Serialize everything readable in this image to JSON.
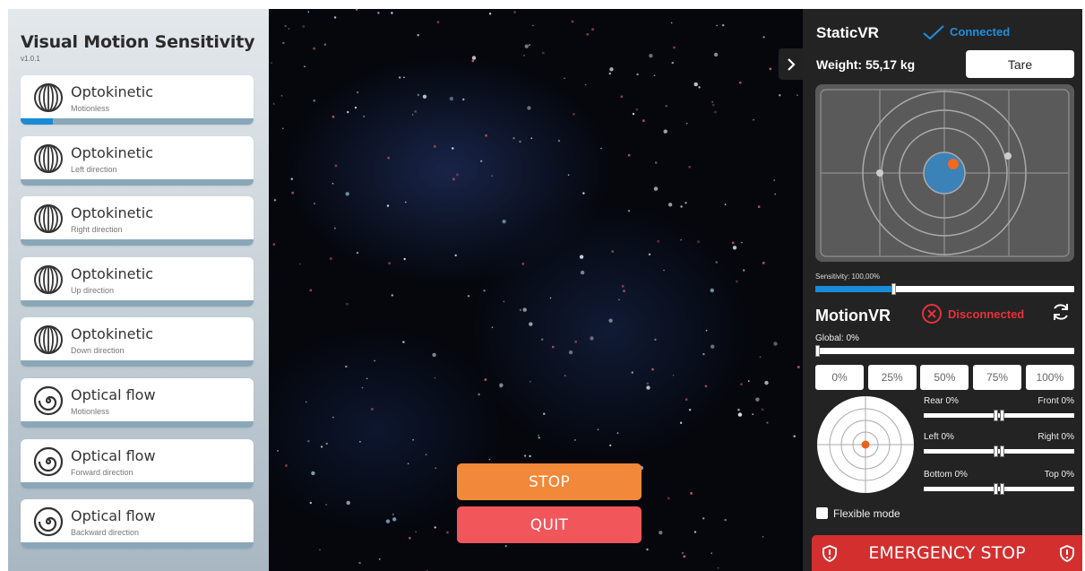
{
  "left_panel": {
    "title": "Visual Motion Sensitivity",
    "version": "v1.0.1",
    "modes": [
      {
        "name": "Optokinetic",
        "subtitle": "Motionless",
        "icon": "sphere-lines-icon",
        "progress": 0.14
      },
      {
        "name": "Optokinetic",
        "subtitle": "Left direction",
        "icon": "sphere-lines-icon",
        "progress": 0
      },
      {
        "name": "Optokinetic",
        "subtitle": "Right direction",
        "icon": "sphere-lines-icon",
        "progress": 0
      },
      {
        "name": "Optokinetic",
        "subtitle": "Up direction",
        "icon": "sphere-lines-icon",
        "progress": 0
      },
      {
        "name": "Optokinetic",
        "subtitle": "Down direction",
        "icon": "sphere-lines-icon",
        "progress": 0
      },
      {
        "name": "Optical flow",
        "subtitle": "Motionless",
        "icon": "spiral-icon",
        "progress": 0
      },
      {
        "name": "Optical flow",
        "subtitle": "Forward direction",
        "icon": "spiral-icon",
        "progress": 0
      },
      {
        "name": "Optical flow",
        "subtitle": "Backward direction",
        "icon": "spiral-icon",
        "progress": 0
      }
    ]
  },
  "stage": {
    "stop_label": "STOP",
    "quit_label": "QUIT",
    "colors": {
      "stop": "#f2883a",
      "quit": "#f0565a"
    }
  },
  "static_vr": {
    "title": "StaticVR",
    "status": "Connected",
    "status_color": "#1f8fe0",
    "weight_label": "Weight: 55,17 kg",
    "tare_label": "Tare",
    "sensitivity_label": "Sensitivity: 100,00%",
    "sensitivity_value": 0.3
  },
  "motion_vr": {
    "title": "MotionVR",
    "status": "Disconnected",
    "status_color": "#e8313a",
    "global_label": "Global: 0%",
    "global_value": 0,
    "presets": [
      "0%",
      "25%",
      "50%",
      "75%",
      "100%"
    ],
    "axes": [
      {
        "left": "Rear 0%",
        "right": "Front 0%"
      },
      {
        "left": "Left 0%",
        "right": "Right 0%"
      },
      {
        "left": "Bottom 0%",
        "right": "Top 0%"
      }
    ],
    "flexible_mode_label": "Flexible mode",
    "flexible_mode_checked": false
  },
  "emergency": {
    "label": "EMERGENCY STOP",
    "color": "#d32f2f"
  }
}
